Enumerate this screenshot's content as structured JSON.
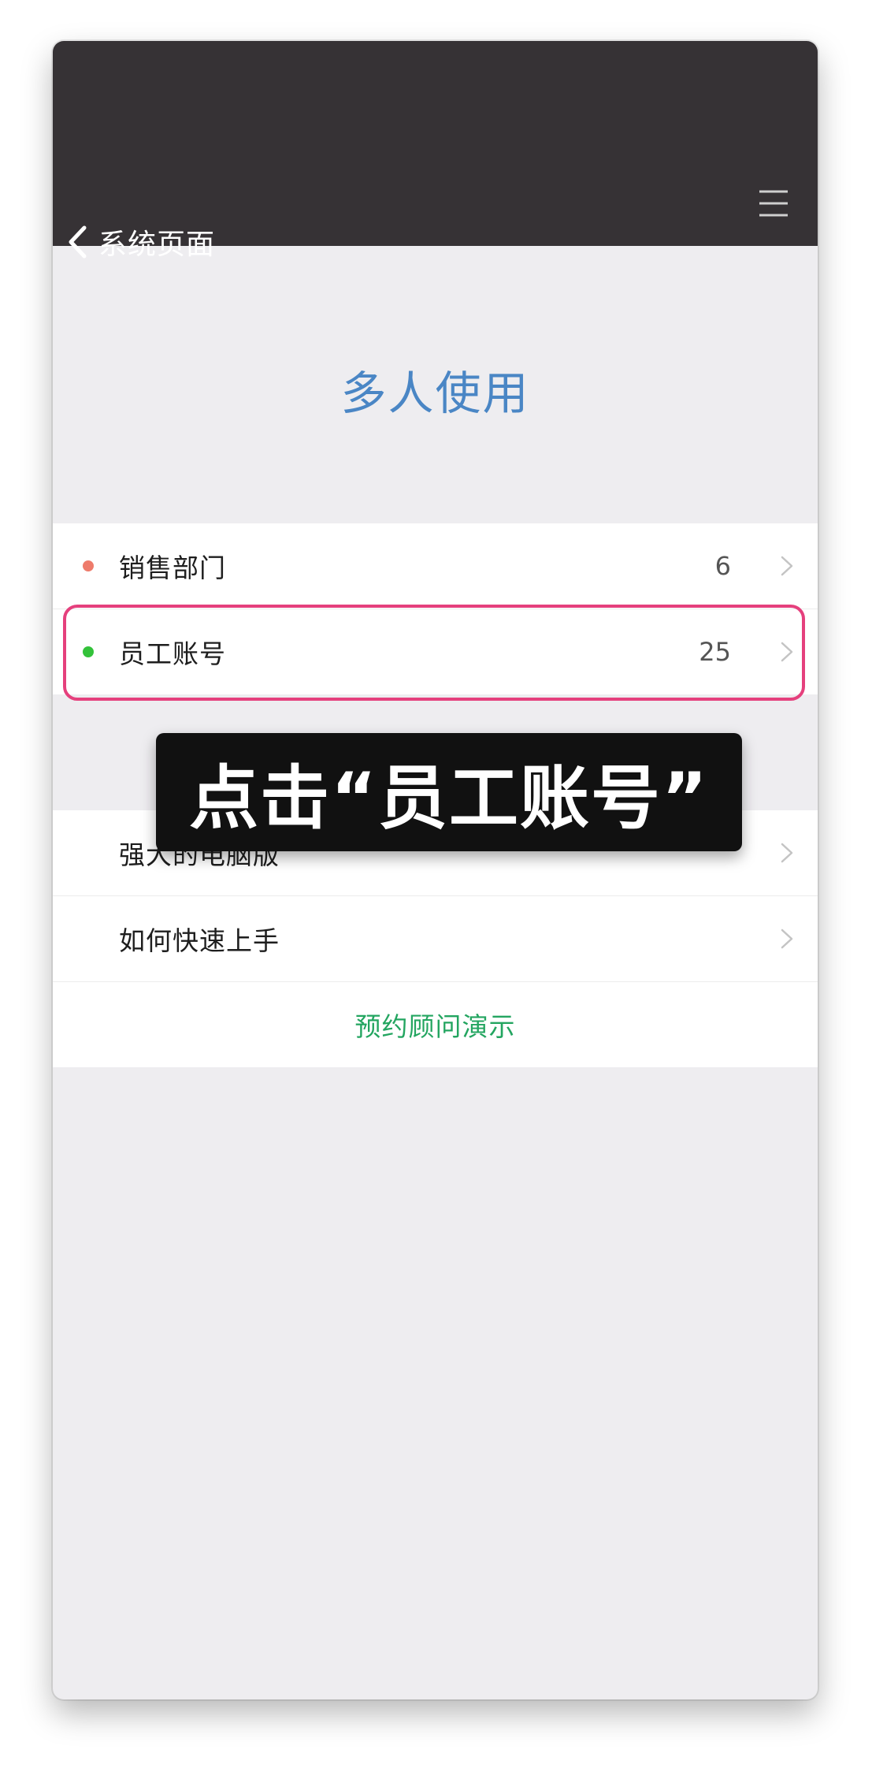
{
  "header": {
    "back_label": "系统页面",
    "back_icon": "chevron-left-icon",
    "menu_icon": "hamburger-menu-icon",
    "background": "#363235"
  },
  "hero": {
    "title": "多人使用",
    "color": "#4a86c5"
  },
  "group1": {
    "items": [
      {
        "label": "销售部门",
        "count": "6",
        "dot_color": "#ee7b6b"
      },
      {
        "label": "员工账号",
        "count": "25",
        "dot_color": "#33c23a"
      }
    ]
  },
  "group2": {
    "items": [
      {
        "label": "强大的电脑版"
      },
      {
        "label": "如何快速上手"
      }
    ],
    "link": "预约顾问演示",
    "link_color": "#23a560"
  },
  "caption": {
    "text": "点击“员工账号”"
  },
  "highlight_color": "#e5407d"
}
